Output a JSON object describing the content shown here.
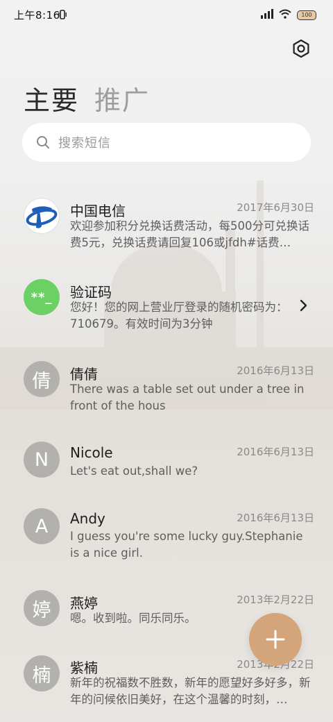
{
  "status": {
    "time": "上午8:16",
    "battery": "100"
  },
  "tabs": [
    {
      "label": "主要"
    },
    {
      "label": "推广"
    }
  ],
  "search": {
    "placeholder": "搜索短信"
  },
  "messages": [
    {
      "sender": "中国电信",
      "date": "2017年6月30日",
      "preview": "欢迎参加积分兑换话费活动，每500分可兑换话费5元，兑换话费请回复106或jfdh#话费…",
      "avatar_type": "telecom-logo"
    },
    {
      "sender": "验证码",
      "date": "",
      "preview": "您好！您的网上营业厅登录的随机密码为：710679。有效时间为3分钟",
      "avatar_text": "**_",
      "avatar_color": "#6bd165"
    },
    {
      "sender": "倩倩",
      "date": "2016年6月13日",
      "preview": "There was a table set out under a tree in front of the hous",
      "avatar_text": "倩"
    },
    {
      "sender": "Nicole",
      "date": "2016年6月13日",
      "preview": "Let's eat out,shall we?",
      "avatar_text": "N"
    },
    {
      "sender": "Andy",
      "date": "2016年6月13日",
      "preview": "I guess you're some lucky guy.Stephanie is a nice girl.",
      "avatar_text": "A"
    },
    {
      "sender": "燕婷",
      "date": "2013年2月22日",
      "preview": "嗯。收到啦。同乐同乐。",
      "avatar_text": "婷"
    },
    {
      "sender": "紫楠",
      "date": "2013年2月22日",
      "preview": "新年的祝福数不胜数，新年的愿望好多好多，新年的问候依旧美好，在这个温馨的时刻，…",
      "avatar_text": "楠"
    }
  ],
  "colors": {
    "fab": "#d4a57a",
    "verification_avatar": "#6bd165",
    "contact_avatar": "#b3b1ae"
  },
  "icons": [
    "settings-hexagon-icon",
    "search-icon",
    "chevron-right-icon",
    "plus-icon",
    "telecom-logo-icon",
    "signal-icon",
    "wifi-icon",
    "battery-icon",
    "vibrate-icon"
  ]
}
